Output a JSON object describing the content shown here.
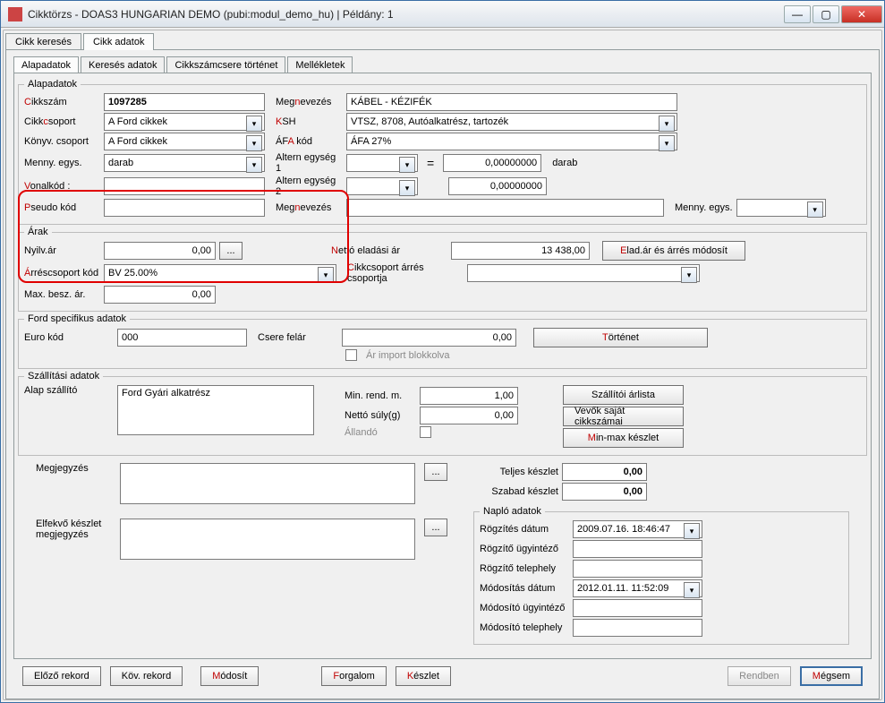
{
  "window": {
    "title": "Cikktörzs - DOAS3 HUNGARIAN DEMO (pubi:modul_demo_hu) | Példány: 1"
  },
  "tabs": {
    "search": "Cikk keresés",
    "data": "Cikk adatok"
  },
  "subtabs": {
    "base": "Alapadatok",
    "search": "Keresés adatok",
    "history": "Cikkszámcsere történet",
    "attach": "Mellékletek"
  },
  "base": {
    "legend": "Alapadatok",
    "cikkszam_label": "ikkszám",
    "cikkszam": "1097285",
    "megnevezes_label": "evezés",
    "megnevezes": "KÁBEL - KÉZIFÉK",
    "cikkcsoport_label": "soport",
    "cikkcsoport": "A Ford cikkek",
    "ksh_label": "SH",
    "ksh": "VTSZ, 8708, Autóalkatrész, tartozék",
    "konyvcs_label": "Könyv. csoport",
    "konyvcs": "A Ford cikkek",
    "afa_label": " kód",
    "afa": "ÁFA 27%",
    "menny_label": "Menny. egys.",
    "menny": "darab",
    "altern1_label": "Altern egység 1",
    "altern1_val": "0,00000000",
    "vonalkod_label": "onalkód :",
    "altern2_label": "Altern egység 2",
    "altern2_val": "0,00000000",
    "altern_unit": "darab",
    "pseudo_label": "seudo kód",
    "megnevezes2_label": "evezés",
    "mennyegys2_label": "Menny. egys."
  },
  "arak": {
    "legend": "Árak",
    "nyilvar_label": "Nyilv.ár",
    "nyilvar": "0,00",
    "btn": "...",
    "netto_label": "ettó eladási ár",
    "netto": "13 438,00",
    "eladar_btn": "lad.ár és árrés módosít",
    "arrescs_label": "rréscsoport kód",
    "arrescs": "BV  25.00%",
    "cikkcs_arres_label": "ikkcsoport árrés csoportja",
    "maxbesz_label": "Max. besz. ár.",
    "maxbesz": "0,00"
  },
  "ford": {
    "legend": "Ford specifikus adatok",
    "euro_label": "Euro kód",
    "euro": "000",
    "csere_label": "Csere felár",
    "csere": "0,00",
    "tortenet_btn": "örténet",
    "import_label": "Ár import blokkolva"
  },
  "szall": {
    "legend": "Szállítási adatok",
    "alap_label": "Alap szállító",
    "alap": "Ford Gyári alkatrész",
    "minrend_label": "Min. rend. m.",
    "minrend": "1,00",
    "nettosuly_label": "Nettó súly(g)",
    "nettosuly": "0,00",
    "allando_label": "Állandó",
    "szallarlist_btn": "Szállítói árlista",
    "vevok_btn": "Vevők saját cikkszámai",
    "minmax_btn": "in-max készlet"
  },
  "bottom": {
    "megjegyzes_label": "Megjegyzés",
    "elfekvo_label": "Elfekvő készlet megjegyzés",
    "teljes_label": "Teljes készlet",
    "teljes": "0,00",
    "szabad_label": "Szabad készlet",
    "szabad": "0,00"
  },
  "naplo": {
    "legend": "Napló adatok",
    "rogzdatum_label": "Rögzítés dátum",
    "rogzdatum": "2009.07.16. 18:46:47",
    "rogzugy_label": "Rögzítő ügyintéző",
    "rogztel_label": "Rögzítő telephely",
    "moddatum_label": "Módosítás dátum",
    "moddatum": "2012.01.11. 11:52:09",
    "modugy_label": "Módosító ügyintéző",
    "modtel_label": "Módosító telephely"
  },
  "footer": {
    "prev": "Előző rekord",
    "next": "Köv. rekord",
    "modosit": "ódosít",
    "forgalom": "orgalom",
    "keszlet": "észlet",
    "rendben": "Rendben",
    "megsem": "égsem"
  }
}
